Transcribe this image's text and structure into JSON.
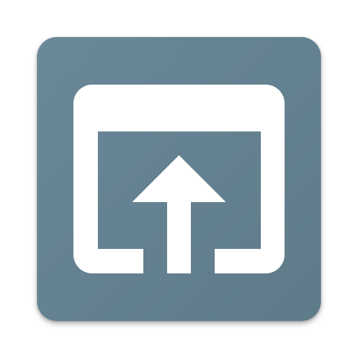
{
  "app_icon": {
    "icon": "open-in-window-upload-icon",
    "colors": {
      "tile_background": "#5f7b8a",
      "tile_gradient_light": "#6a8898",
      "glyph": "#ffffff"
    }
  }
}
